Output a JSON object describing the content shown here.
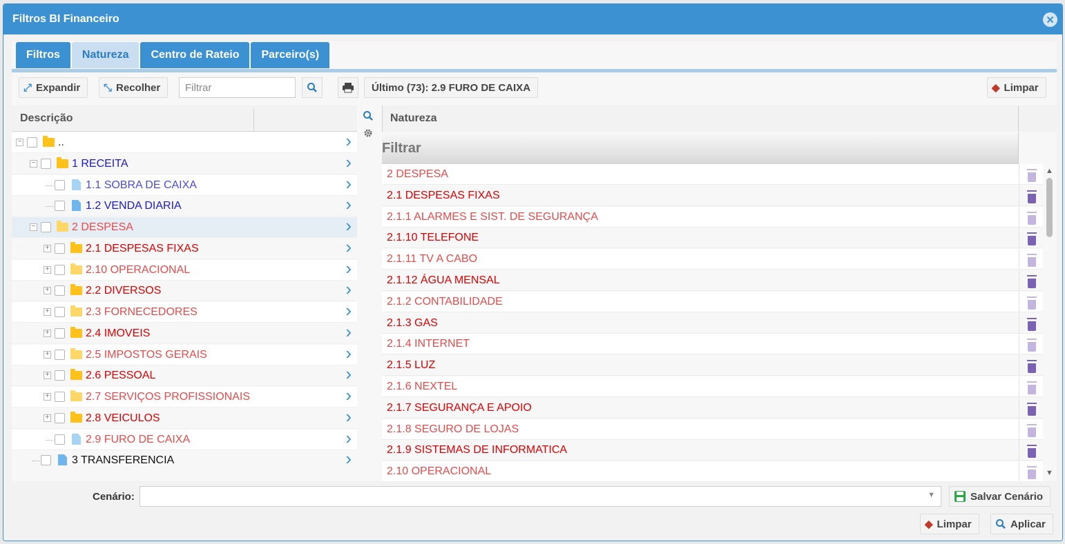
{
  "window": {
    "title": "Filtros BI Financeiro"
  },
  "tabs": [
    {
      "label": "Filtros",
      "active": false
    },
    {
      "label": "Natureza",
      "active": true
    },
    {
      "label": "Centro de Rateio",
      "active": false
    },
    {
      "label": "Parceiro(s)",
      "active": false
    }
  ],
  "toolbar": {
    "expand_label": "Expandir",
    "collapse_label": "Recolher",
    "filter_placeholder": "Filtrar",
    "last_label": "Último (73): 2.9 FURO DE CAIXA",
    "clear_label": "Limpar"
  },
  "tree": {
    "header": "Descrição",
    "rows": [
      {
        "label": "..",
        "level": 0,
        "kind": "folder",
        "color": "#333333",
        "faded": false,
        "expander": "minus",
        "selected": false
      },
      {
        "label": "1 RECEITA",
        "level": 1,
        "kind": "folder",
        "color": "#1a1acc",
        "faded": false,
        "expander": "minus",
        "selected": false
      },
      {
        "label": "1.1 SOBRA DE CAIXA",
        "level": 2,
        "kind": "doc",
        "color": "#4a4ae0",
        "faded": true,
        "expander": "none",
        "selected": false
      },
      {
        "label": "1.2 VENDA DIARIA",
        "level": 2,
        "kind": "doc",
        "color": "#1a1acc",
        "faded": false,
        "expander": "none",
        "selected": false
      },
      {
        "label": "2 DESPESA",
        "level": 1,
        "kind": "folder",
        "color": "#e84a4a",
        "faded": true,
        "expander": "minus",
        "selected": true
      },
      {
        "label": "2.1 DESPESAS FIXAS",
        "level": 2,
        "kind": "folder",
        "color": "#dd0000",
        "faded": false,
        "expander": "plus",
        "selected": false
      },
      {
        "label": "2.10 OPERACIONAL",
        "level": 2,
        "kind": "folder",
        "color": "#e84a4a",
        "faded": true,
        "expander": "plus",
        "selected": false
      },
      {
        "label": "2.2 DIVERSOS",
        "level": 2,
        "kind": "folder",
        "color": "#dd0000",
        "faded": false,
        "expander": "plus",
        "selected": false
      },
      {
        "label": "2.3 FORNECEDORES",
        "level": 2,
        "kind": "folder",
        "color": "#e84a4a",
        "faded": true,
        "expander": "plus",
        "selected": false
      },
      {
        "label": "2.4 IMOVEIS",
        "level": 2,
        "kind": "folder",
        "color": "#dd0000",
        "faded": false,
        "expander": "plus",
        "selected": false
      },
      {
        "label": "2.5 IMPOSTOS GERAIS",
        "level": 2,
        "kind": "folder",
        "color": "#e84a4a",
        "faded": true,
        "expander": "plus",
        "selected": false
      },
      {
        "label": "2.6 PESSOAL",
        "level": 2,
        "kind": "folder",
        "color": "#dd0000",
        "faded": false,
        "expander": "plus",
        "selected": false
      },
      {
        "label": "2.7 SERVIÇOS PROFISSIONAIS",
        "level": 2,
        "kind": "folder",
        "color": "#e84a4a",
        "faded": true,
        "expander": "plus",
        "selected": false
      },
      {
        "label": "2.8 VEICULOS",
        "level": 2,
        "kind": "folder",
        "color": "#dd0000",
        "faded": false,
        "expander": "plus",
        "selected": false
      },
      {
        "label": "2.9 FURO DE CAIXA",
        "level": 2,
        "kind": "doc",
        "color": "#e84a4a",
        "faded": true,
        "expander": "none",
        "selected": false
      },
      {
        "label": "3 TRANSFERENCIA",
        "level": 1,
        "kind": "doc",
        "color": "#111111",
        "faded": false,
        "expander": "none",
        "selected": false
      }
    ]
  },
  "grid": {
    "header": "Natureza",
    "filter_label": "Filtrar",
    "rows": [
      {
        "label": "2 DESPESA",
        "color": "#e84a4a",
        "faded": true
      },
      {
        "label": "2.1 DESPESAS FIXAS",
        "color": "#dd0000",
        "faded": false
      },
      {
        "label": "2.1.1 ALARMES E SIST. DE SEGURANÇA",
        "color": "#e84a4a",
        "faded": true
      },
      {
        "label": "2.1.10 TELEFONE",
        "color": "#dd0000",
        "faded": false
      },
      {
        "label": "2.1.11 TV A CABO",
        "color": "#e84a4a",
        "faded": true
      },
      {
        "label": "2.1.12 ÁGUA MENSAL",
        "color": "#dd0000",
        "faded": false
      },
      {
        "label": "2.1.2 CONTABILIDADE",
        "color": "#e84a4a",
        "faded": true
      },
      {
        "label": "2.1.3 GAS",
        "color": "#dd0000",
        "faded": false
      },
      {
        "label": "2.1.4 INTERNET",
        "color": "#e84a4a",
        "faded": true
      },
      {
        "label": "2.1.5 LUZ",
        "color": "#dd0000",
        "faded": false
      },
      {
        "label": "2.1.6 NEXTEL",
        "color": "#e84a4a",
        "faded": true
      },
      {
        "label": "2.1.7 SEGURANÇA E APOIO",
        "color": "#dd0000",
        "faded": false
      },
      {
        "label": "2.1.8 SEGURO DE LOJAS",
        "color": "#e84a4a",
        "faded": true
      },
      {
        "label": "2.1.9 SISTEMAS DE INFORMATICA",
        "color": "#dd0000",
        "faded": false
      },
      {
        "label": "2.10 OPERACIONAL",
        "color": "#e84a4a",
        "faded": true
      }
    ]
  },
  "scenario": {
    "label": "Cenário:",
    "value": "",
    "save_label": "Salvar Cenário"
  },
  "footer": {
    "clear_label": "Limpar",
    "apply_label": "Aplicar"
  },
  "colors": {
    "accent": "#3c91d3",
    "trash": "#7b62b3"
  }
}
